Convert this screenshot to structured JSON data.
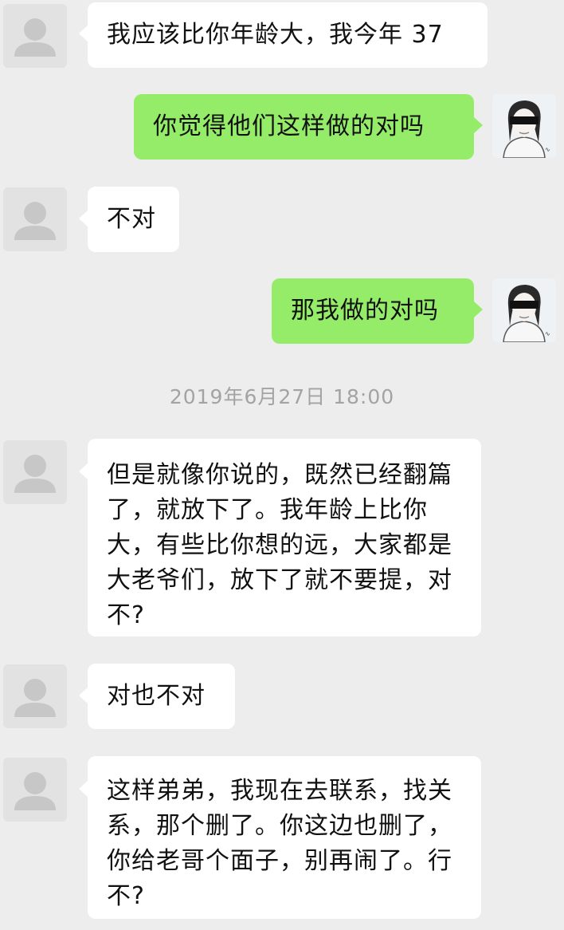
{
  "messages": [
    {
      "side": "left",
      "text": "我应该比你年龄大，我今年 37"
    },
    {
      "side": "right",
      "text": "你觉得他们这样做的对吗"
    },
    {
      "side": "left",
      "text": "不对"
    },
    {
      "side": "right",
      "text": "那我做的对吗"
    },
    {
      "side": "left",
      "text": "但是就像你说的，既然已经翻篇了，就放下了。我年龄上比你大，有些比你想的远，大家都是大老爷们，放下了就不要提，对不?"
    },
    {
      "side": "left",
      "text": "对也不对"
    },
    {
      "side": "left",
      "text": "这样弟弟，我现在去联系，找关系，那个删了。你这边也删了，你给老哥个面子，别再闹了。行不?"
    }
  ],
  "timestamp": "2019年6月27日 18:00",
  "icons": {
    "contact_avatar": "default-person-icon",
    "user_avatar": "anime-portrait-avatar"
  },
  "colors": {
    "background": "#ededed",
    "sent_bubble": "#95ec69",
    "received_bubble": "#ffffff"
  }
}
